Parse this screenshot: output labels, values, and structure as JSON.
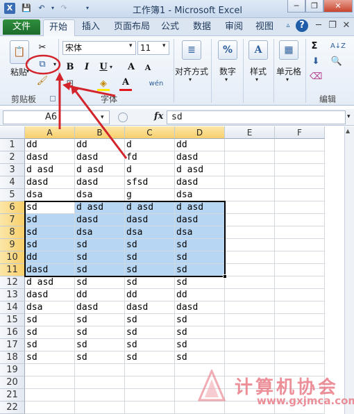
{
  "window": {
    "title": "工作簿1 - Microsoft Excel",
    "minimize": "─",
    "restore": "❐",
    "close": "✕"
  },
  "qat": {
    "save": "💾",
    "undo": "↶",
    "redo": "↷"
  },
  "tabs": [
    {
      "label": "文件"
    },
    {
      "label": "开始"
    },
    {
      "label": "插入"
    },
    {
      "label": "页面布局"
    },
    {
      "label": "公式"
    },
    {
      "label": "数据"
    },
    {
      "label": "审阅"
    },
    {
      "label": "视图"
    }
  ],
  "ribbon": {
    "clipboard": {
      "paste": "粘贴",
      "group": "剪贴板"
    },
    "font": {
      "name": "宋体",
      "size": "11",
      "bold": "B",
      "italic": "I",
      "underline": "U",
      "grow": "A",
      "shrink": "A",
      "font_color": "A",
      "wen": "wén",
      "group": "字体"
    },
    "align": {
      "label": "对齐方式"
    },
    "number": {
      "label": "数字",
      "icon": "%"
    },
    "styles": {
      "label": "样式",
      "icon": "A"
    },
    "cells": {
      "label": "单元格"
    },
    "editing": {
      "group": "编辑",
      "sum": "Σ",
      "sort": "A↓Z",
      "find": "🔍"
    }
  },
  "formula_bar": {
    "name_box": "A6",
    "fx": "fx",
    "content": "sd"
  },
  "columns": [
    "A",
    "B",
    "C",
    "D",
    "E",
    "F"
  ],
  "selected_columns": [
    "A",
    "B",
    "C",
    "D"
  ],
  "rows": [
    [
      "dd",
      "dd",
      "d",
      "dd"
    ],
    [
      "dasd",
      "dasd",
      "fd",
      "dasd"
    ],
    [
      "d asd",
      "d asd",
      "d",
      "d asd"
    ],
    [
      "dasd",
      "dasd",
      "sfsd",
      "dasd"
    ],
    [
      "dsa",
      "dsa",
      "g",
      "dsa"
    ],
    [
      "sd",
      "d asd",
      "d asd",
      "d asd"
    ],
    [
      "sd",
      "dasd",
      "dasd",
      "dasd"
    ],
    [
      "sd",
      "dsa",
      "dsa",
      "dsa"
    ],
    [
      "sd",
      "sd",
      "sd",
      "sd"
    ],
    [
      "dd",
      "sd",
      "sd",
      "sd"
    ],
    [
      "dasd",
      "sd",
      "sd",
      "sd"
    ],
    [
      "d asd",
      "sd",
      "sd",
      "sd"
    ],
    [
      "dasd",
      "dd",
      "dd",
      "dd"
    ],
    [
      "dsa",
      "dasd",
      "dasd",
      "dasd"
    ],
    [
      "sd",
      "sd",
      "sd",
      "sd"
    ],
    [
      "sd",
      "sd",
      "sd",
      "sd"
    ],
    [
      "sd",
      "sd",
      "sd",
      "sd"
    ],
    [
      "sd",
      "sd",
      "sd",
      "sd"
    ],
    [
      "",
      "",
      "",
      ""
    ],
    [
      "",
      "",
      "",
      ""
    ],
    [
      "",
      "",
      "",
      ""
    ],
    [
      "",
      "",
      "",
      ""
    ]
  ],
  "selection": {
    "first_row": 6,
    "last_row": 11,
    "active_cell": "A6"
  },
  "watermark": {
    "text": "计算机协会",
    "url": "www.gxjmca.com"
  },
  "colors": {
    "file_tab": "#1d6b2b",
    "selection": "#b7d6f3",
    "header_selected": "#f8cf6b",
    "annotation": "#d3232b"
  }
}
